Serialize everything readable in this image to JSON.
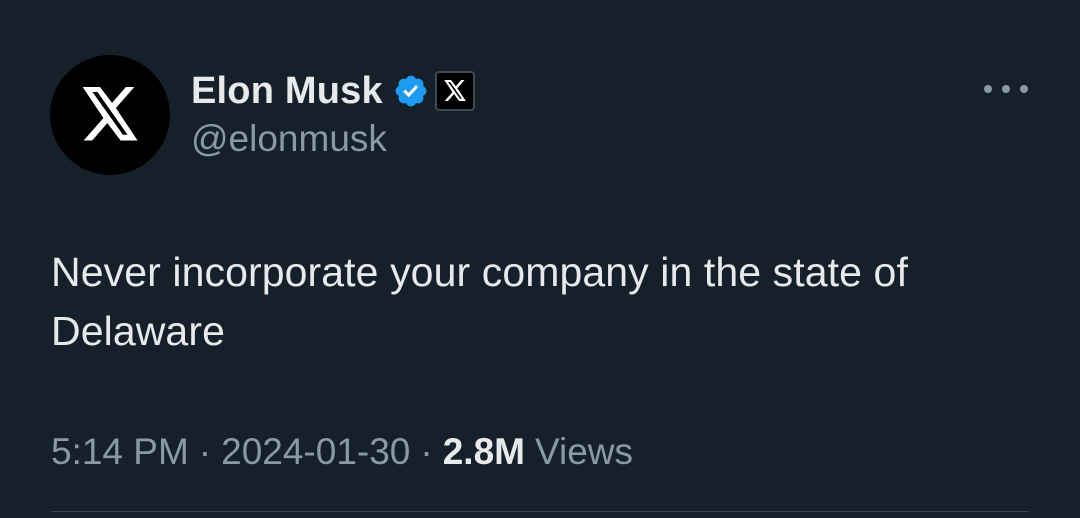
{
  "author": {
    "display_name": "Elon Musk",
    "handle": "@elonmusk",
    "avatar_icon": "x-logo-icon",
    "verified_badge_icon": "verified-badge-icon",
    "verified_color": "#1d9bf0",
    "affiliate_badge_icon": "x-affiliate-badge-icon"
  },
  "menu": {
    "more_icon": "more-horizontal-icon"
  },
  "tweet": {
    "text": "Never incorporate your company in the state of Delaware"
  },
  "meta": {
    "time": "5:14 PM",
    "separator": "·",
    "date": "2024-01-30",
    "views_count": "2.8M",
    "views_label": "Views"
  },
  "colors": {
    "background": "#15202b",
    "primary_text": "#e7e9ea",
    "secondary_text": "#8b98a5"
  }
}
